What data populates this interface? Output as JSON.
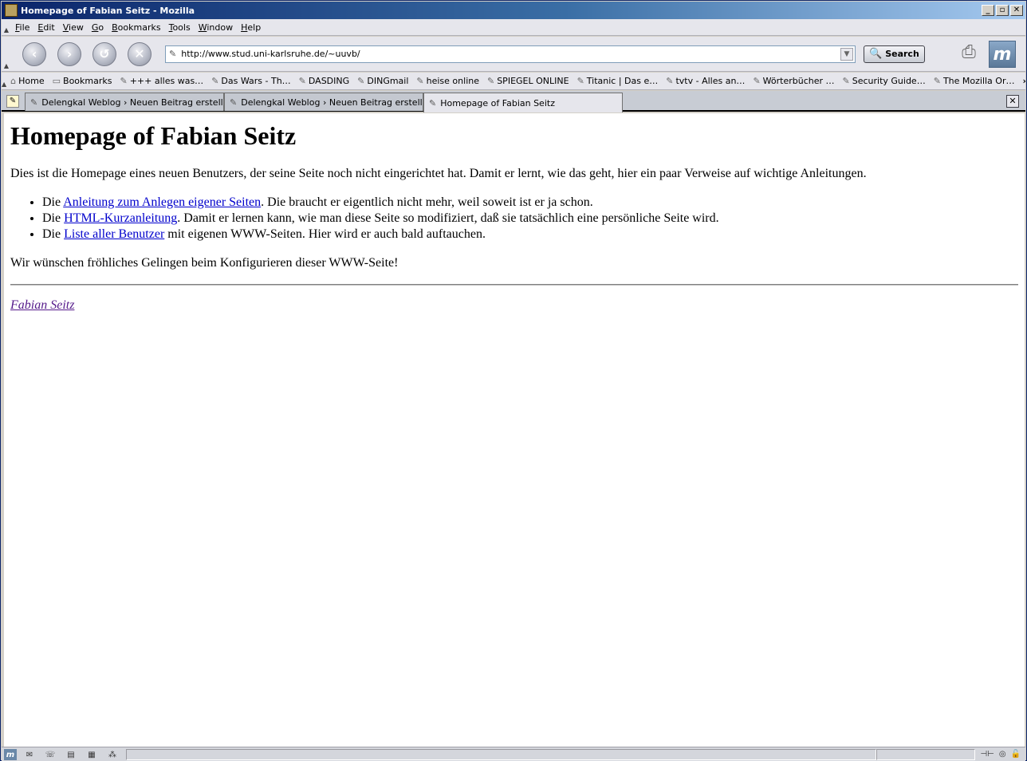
{
  "window": {
    "title": "Homepage of Fabian Seitz - Mozilla",
    "minimize": "_",
    "restore": "▫",
    "close": "✕"
  },
  "menu": [
    "File",
    "Edit",
    "View",
    "Go",
    "Bookmarks",
    "Tools",
    "Window",
    "Help"
  ],
  "nav": {
    "back_icon": "arrow-left-icon",
    "forward_icon": "arrow-right-icon",
    "reload_icon": "reload-icon",
    "stop_icon": "stop-icon",
    "url": "http://www.stud.uni-karlsruhe.de/~uuvb/",
    "search_label": "Search"
  },
  "bookmarks": {
    "home": "Home",
    "folder": "Bookmarks",
    "items": [
      "+++ alles was…",
      "Das Wars - Th…",
      "DASDING",
      "DINGmail",
      "heise online",
      "SPIEGEL ONLINE",
      "Titanic | Das e…",
      "tvtv - Alles an…",
      "Wörterbücher …",
      "Security Guide…",
      "The Mozilla Or…"
    ],
    "more": "»"
  },
  "tabs": [
    {
      "label": "Delengkal Weblog › Neuen Beitrag erstellen…",
      "active": false
    },
    {
      "label": "Delengkal Weblog › Neuen Beitrag erstellen…",
      "active": false
    },
    {
      "label": "Homepage of Fabian Seitz",
      "active": true
    }
  ],
  "tab_close": "✕",
  "page": {
    "heading": "Homepage of Fabian Seitz",
    "intro": "Dies ist die Homepage eines neuen Benutzers, der seine Seite noch nicht eingerichtet hat. Damit er lernt, wie das geht, hier ein paar Verweise auf wichtige Anleitungen.",
    "list": [
      {
        "prefix": "Die ",
        "link": "Anleitung zum Anlegen eigener Seiten",
        "suffix": ". Die braucht er eigentlich nicht mehr, weil soweit ist er ja schon."
      },
      {
        "prefix": "Die ",
        "link": "HTML-Kurzanleitung",
        "suffix": ". Damit er lernen kann, wie man diese Seite so modifiziert, daß sie tatsächlich eine persönliche Seite wird."
      },
      {
        "prefix": "Die ",
        "link": "Liste aller Benutzer",
        "suffix": " mit eigenen WWW-Seiten. Hier wird er auch bald auftauchen."
      }
    ],
    "closing": "Wir wünschen fröhliches Gelingen beim Konfigurieren dieser WWW-Seite!",
    "signature": "Fabian Seitz"
  },
  "status": {
    "text": ""
  }
}
